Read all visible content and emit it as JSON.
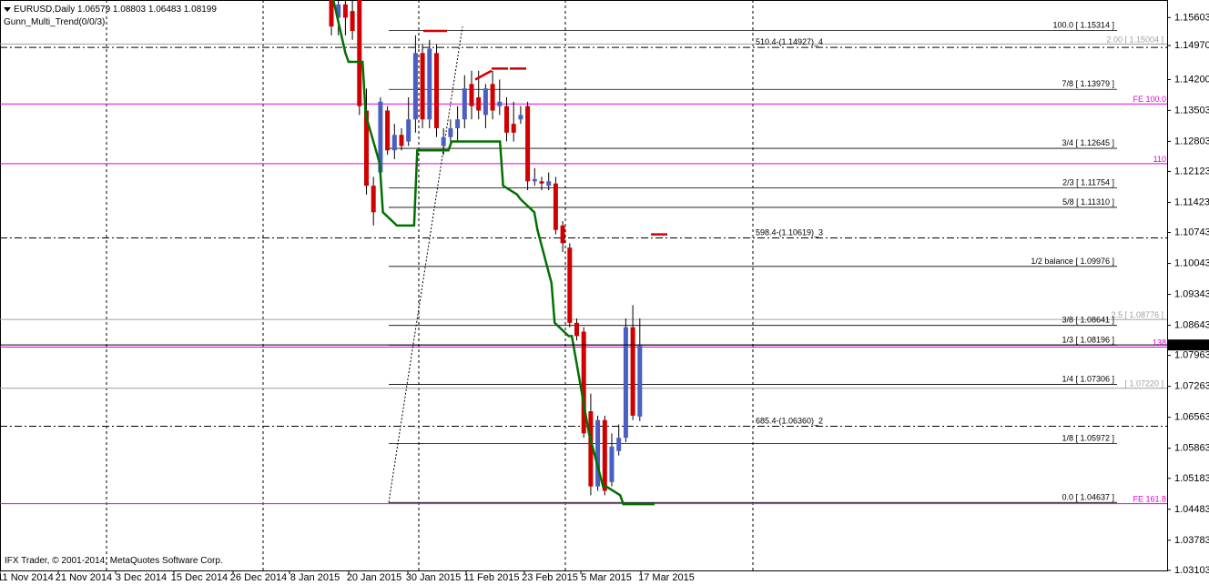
{
  "header": {
    "symbol_line": "EURUSD,Daily  1.06579 1.08803 1.06483 1.08199",
    "indicator": "Gunn_Multi_Trend(0/0/3)"
  },
  "footer": {
    "copyright": "IFX Trader, © 2001-2014, MetaQuotes Software Corp."
  },
  "current_price": "1.08199",
  "colors": {
    "bull": "#4a5fc1",
    "bear": "#d00000",
    "trend": "#007000",
    "magenta": "#e000e0",
    "gray": "#a0a0a0"
  },
  "chart_data": {
    "type": "candlestick",
    "ylim": [
      1.031,
      1.16
    ],
    "y_ticks": [
      "1.15603",
      "1.14970",
      "1.14200",
      "1.13503",
      "1.12803",
      "1.12123",
      "1.11423",
      "1.10743",
      "1.10043",
      "1.09343",
      "1.08643",
      "1.07963",
      "1.07263",
      "1.06563",
      "1.05863",
      "1.05183",
      "1.04483",
      "1.03783",
      "1.03103"
    ],
    "x_labels": [
      "11 Nov 2014",
      "21 Nov 2014",
      "3 Dec 2014",
      "15 Dec 2014",
      "26 Dec 2014",
      "8 Jan 2015",
      "20 Jan 2015",
      "30 Jan 2015",
      "11 Feb 2015",
      "23 Feb 2015",
      "5 Mar 2015",
      "17 Mar 2015"
    ],
    "candles": [
      {
        "o": 1.1635,
        "h": 1.165,
        "l": 1.152,
        "c": 1.154
      },
      {
        "o": 1.156,
        "h": 1.162,
        "l": 1.152,
        "c": 1.159
      },
      {
        "o": 1.159,
        "h": 1.162,
        "l": 1.152,
        "c": 1.156
      },
      {
        "o": 1.1575,
        "h": 1.16,
        "l": 1.151,
        "c": 1.153
      },
      {
        "o": 1.16,
        "h": 1.162,
        "l": 1.134,
        "c": 1.136
      },
      {
        "o": 1.135,
        "h": 1.14,
        "l": 1.116,
        "c": 1.118
      },
      {
        "o": 1.118,
        "h": 1.12,
        "l": 1.109,
        "c": 1.112
      },
      {
        "o": 1.121,
        "h": 1.138,
        "l": 1.1195,
        "c": 1.137
      },
      {
        "o": 1.135,
        "h": 1.136,
        "l": 1.125,
        "c": 1.126
      },
      {
        "o": 1.126,
        "h": 1.132,
        "l": 1.124,
        "c": 1.1295
      },
      {
        "o": 1.1295,
        "h": 1.131,
        "l": 1.126,
        "c": 1.127
      },
      {
        "o": 1.128,
        "h": 1.138,
        "l": 1.127,
        "c": 1.133
      },
      {
        "o": 1.133,
        "h": 1.152,
        "l": 1.13,
        "c": 1.148
      },
      {
        "o": 1.148,
        "h": 1.15,
        "l": 1.131,
        "c": 1.133
      },
      {
        "o": 1.133,
        "h": 1.151,
        "l": 1.131,
        "c": 1.149
      },
      {
        "o": 1.148,
        "h": 1.15,
        "l": 1.129,
        "c": 1.131
      },
      {
        "o": 1.127,
        "h": 1.131,
        "l": 1.125,
        "c": 1.129
      },
      {
        "o": 1.129,
        "h": 1.133,
        "l": 1.127,
        "c": 1.131
      },
      {
        "o": 1.131,
        "h": 1.136,
        "l": 1.128,
        "c": 1.133
      },
      {
        "o": 1.133,
        "h": 1.143,
        "l": 1.131,
        "c": 1.14
      },
      {
        "o": 1.141,
        "h": 1.144,
        "l": 1.133,
        "c": 1.136
      },
      {
        "o": 1.138,
        "h": 1.144,
        "l": 1.133,
        "c": 1.135
      },
      {
        "o": 1.134,
        "h": 1.141,
        "l": 1.131,
        "c": 1.14
      },
      {
        "o": 1.141,
        "h": 1.144,
        "l": 1.133,
        "c": 1.135
      },
      {
        "o": 1.136,
        "h": 1.142,
        "l": 1.134,
        "c": 1.137
      },
      {
        "o": 1.136,
        "h": 1.138,
        "l": 1.128,
        "c": 1.13
      },
      {
        "o": 1.132,
        "h": 1.137,
        "l": 1.128,
        "c": 1.13
      },
      {
        "o": 1.133,
        "h": 1.136,
        "l": 1.132,
        "c": 1.134
      },
      {
        "o": 1.136,
        "h": 1.137,
        "l": 1.117,
        "c": 1.119
      },
      {
        "o": 1.119,
        "h": 1.122,
        "l": 1.118,
        "c": 1.1195
      },
      {
        "o": 1.119,
        "h": 1.12,
        "l": 1.117,
        "c": 1.1185
      },
      {
        "o": 1.118,
        "h": 1.121,
        "l": 1.117,
        "c": 1.119
      },
      {
        "o": 1.1185,
        "h": 1.12,
        "l": 1.107,
        "c": 1.108
      },
      {
        "o": 1.109,
        "h": 1.11,
        "l": 1.103,
        "c": 1.105
      },
      {
        "o": 1.104,
        "h": 1.105,
        "l": 1.086,
        "c": 1.087
      },
      {
        "o": 1.087,
        "h": 1.088,
        "l": 1.083,
        "c": 1.084
      },
      {
        "o": 1.085,
        "h": 1.086,
        "l": 1.061,
        "c": 1.062
      },
      {
        "o": 1.067,
        "h": 1.071,
        "l": 1.048,
        "c": 1.05
      },
      {
        "o": 1.05,
        "h": 1.066,
        "l": 1.049,
        "c": 1.065
      },
      {
        "o": 1.065,
        "h": 1.066,
        "l": 1.048,
        "c": 1.049
      },
      {
        "o": 1.051,
        "h": 1.062,
        "l": 1.05,
        "c": 1.059
      },
      {
        "o": 1.058,
        "h": 1.064,
        "l": 1.057,
        "c": 1.061
      },
      {
        "o": 1.061,
        "h": 1.088,
        "l": 1.06,
        "c": 1.086
      },
      {
        "o": 1.086,
        "h": 1.091,
        "l": 1.065,
        "c": 1.066
      },
      {
        "o": 1.0658,
        "h": 1.088,
        "l": 1.0648,
        "c": 1.082
      }
    ],
    "gann_levels": [
      {
        "label": "100.0   [ 1.15314 ]",
        "value": 1.15314
      },
      {
        "label": "7/8   [ 1.13979 ]",
        "value": 1.13979
      },
      {
        "label": "3/4   [ 1.12645 ]",
        "value": 1.12645
      },
      {
        "label": "2/3   [ 1.11754 ]",
        "value": 1.11754
      },
      {
        "label": "5/8   [ 1.11310 ]",
        "value": 1.1131
      },
      {
        "label": "1/2 balance   [ 1.09976 ]",
        "value": 1.09976
      },
      {
        "label": "3/8   [ 1.08641 ]",
        "value": 1.08641
      },
      {
        "label": "1/3   [ 1.08196 ]",
        "value": 1.08196
      },
      {
        "label": "1/4   [ 1.07306 ]",
        "value": 1.07306
      },
      {
        "label": "1/8   [ 1.05972 ]",
        "value": 1.05972
      },
      {
        "label": "0.0   [ 1.04637 ]",
        "value": 1.04637
      }
    ],
    "time_levels": [
      {
        "label": "510.4-(1.14927)_4",
        "value": 1.14927
      },
      {
        "label": "598.4-(1.10619)_3",
        "value": 1.10619
      },
      {
        "label": "685.4-(1.06360)_2",
        "value": 1.0636
      }
    ],
    "gray_levels": [
      {
        "label": "2.00   [ 1.15004 ]",
        "value": 1.15004
      },
      {
        "label": "2.5   [ 1.08776 ]",
        "value": 1.08776
      },
      {
        "label": "   [ 1.07220 ]",
        "value": 1.0722
      }
    ],
    "magenta_levels": [
      {
        "label": "FE 100.0",
        "value": 1.1365
      },
      {
        "label": "110",
        "value": 1.123
      },
      {
        "label": "138",
        "value": 1.0815
      },
      {
        "label": "FE 161.8",
        "value": 1.0461
      }
    ],
    "trend_line": [
      [
        1.162,
        1.148
      ],
      [
        1.146,
        1.146
      ],
      [
        1.134,
        1.123
      ],
      [
        1.112,
        1.109
      ],
      [
        1.109,
        1.109
      ],
      [
        1.126,
        1.126
      ],
      [
        1.126,
        1.126
      ],
      [
        1.128,
        1.128
      ],
      [
        1.128,
        1.128
      ],
      [
        1.128,
        1.128
      ],
      [
        1.118,
        1.116
      ],
      [
        1.115,
        1.112
      ],
      [
        1.108,
        1.096
      ],
      [
        1.087,
        1.084
      ],
      [
        1.084,
        1.066
      ],
      [
        1.062,
        1.05
      ],
      [
        1.05,
        1.048
      ],
      [
        1.046,
        1.046
      ],
      [
        1.046,
        1.046
      ]
    ],
    "resist_line": [
      [
        1.153,
        1.153
      ],
      [
        1.142,
        1.144
      ],
      [
        1.1445,
        1.1445
      ],
      [
        1.1445,
        1.1445
      ],
      [
        1.107,
        1.107
      ]
    ]
  }
}
